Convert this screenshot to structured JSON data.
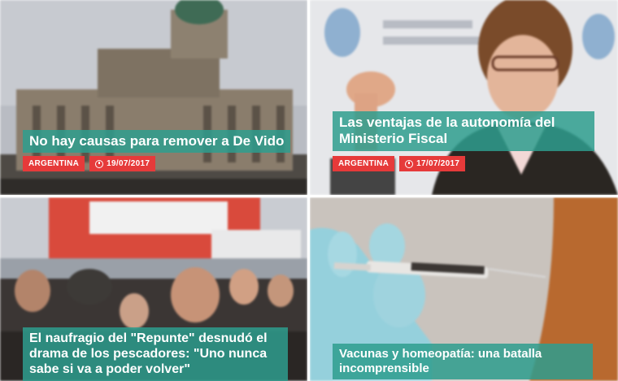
{
  "news_grid": {
    "items": [
      {
        "headline": "No hay causas para remover a De Vido",
        "category": "ARGENTINA",
        "date": "19/07/2017"
      },
      {
        "headline": "Las ventajas de la autonomía del Ministerio Fiscal",
        "category": "ARGENTINA",
        "date": "17/07/2017"
      },
      {
        "headline": "El naufragio del \"Repunte\" desnudó el drama de los pescadores: \"Uno nunca sabe si va a poder volver\"",
        "category": "",
        "date": ""
      },
      {
        "headline": "Vacunas y homeopatía: una batalla incomprensible",
        "category": "",
        "date": ""
      }
    ]
  },
  "colors": {
    "headline_bg": "#2e9d8e",
    "tag_bg": "#e63a3a"
  },
  "icons": {
    "date": "clock-icon"
  }
}
